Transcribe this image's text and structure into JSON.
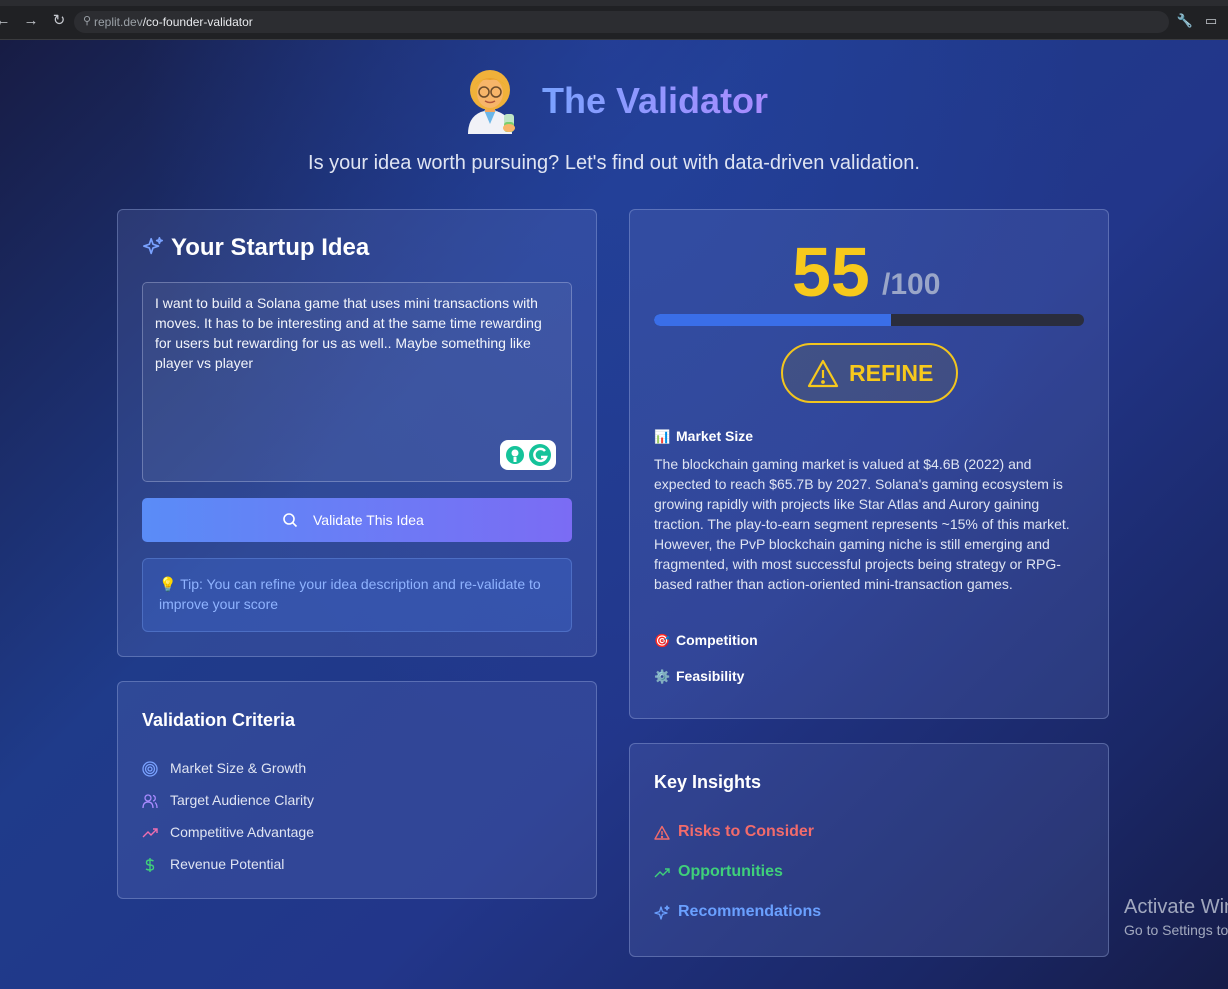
{
  "browser": {
    "url_host": "replit.dev",
    "url_path": "/co-founder-validator"
  },
  "hero": {
    "title": "The Validator",
    "subtitle": "Is your idea worth pursuing? Let's find out with data-driven validation."
  },
  "idea": {
    "title": "Your Startup Idea",
    "text": "I want to build a Solana game that uses mini transactions with moves. It has to be interesting and at the same time rewarding for users but rewarding for us as well.. Maybe something like player vs player",
    "button_label": "Validate This Idea",
    "tip": "💡 Tip: You can refine your idea description and re-validate to improve your score"
  },
  "criteria": {
    "title": "Validation Criteria",
    "items": [
      {
        "label": "Market Size & Growth",
        "icon": "target-icon",
        "color": "#7aa2ff"
      },
      {
        "label": "Target Audience Clarity",
        "icon": "users-icon",
        "color": "#a98bff"
      },
      {
        "label": "Competitive Advantage",
        "icon": "trending-up-icon",
        "color": "#f06eb0"
      },
      {
        "label": "Revenue Potential",
        "icon": "dollar-icon",
        "color": "#3fd07a"
      }
    ]
  },
  "score": {
    "value": "55",
    "max_label": "/100",
    "fraction": 0.55,
    "verdict": "REFINE",
    "verdict_color": "#f7c91c"
  },
  "analysis": {
    "market_size_title": "Market Size",
    "market_size_text": "The blockchain gaming market is valued at $4.6B (2022) and expected to reach $65.7B by 2027. Solana's gaming ecosystem is growing rapidly with projects like Star Atlas and Aurory gaining traction. The play-to-earn segment represents ~15% of this market. However, the PvP blockchain gaming niche is still emerging and fragmented, with most successful projects being strategy or RPG-based rather than action-oriented mini-transaction games.",
    "competition_title": "Competition",
    "feasibility_title": "Feasibility"
  },
  "insights": {
    "title": "Key Insights",
    "risks": "Risks to Consider",
    "opportunities": "Opportunities",
    "recommendations": "Recommendations",
    "colors": {
      "risks": "#f26b6b",
      "opportunities": "#3fd07a",
      "recommendations": "#6aa0ff"
    }
  },
  "windows_watermark": {
    "line1": "Activate Windows",
    "line2": "Go to Settings to activate Windows."
  }
}
